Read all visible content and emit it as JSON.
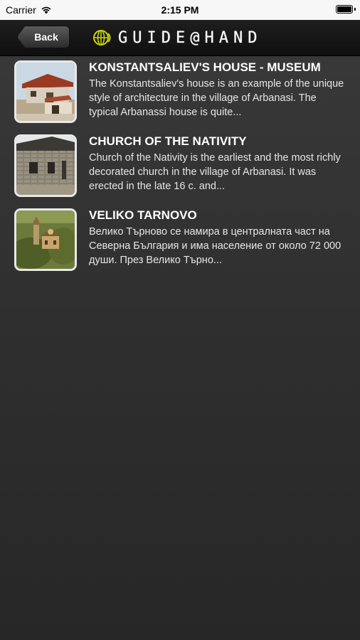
{
  "status_bar": {
    "carrier": "Carrier",
    "time": "2:15 PM"
  },
  "nav": {
    "back_label": "Back",
    "logo_text": "GUIDE@HAND"
  },
  "items": [
    {
      "title": "KONSTANTSALIEV'S HOUSE - MUSEUM",
      "description": "The Konstantsaliev's house is an example of the unique style of architecture in the village of Arbanasi. The typical Arbanassi house is quite..."
    },
    {
      "title": "CHURCH OF THE NATIVITY",
      "description": "Church of the Nativity is the earliest and the most richly decorated church in the village of Arbanasi. It was erected in the late 16 c. and..."
    },
    {
      "title": "VELIKO TARNOVO",
      "description": "Велико Търново се намира в централната част на Северна България и има население от около 72 000 души. През Велико Търно..."
    }
  ],
  "colors": {
    "accent": "#c8d400",
    "background": "#303030"
  }
}
